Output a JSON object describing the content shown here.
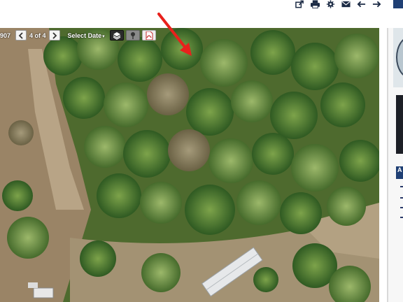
{
  "header": {
    "tools": [
      {
        "name": "share-icon"
      },
      {
        "name": "print-icon"
      },
      {
        "name": "gear-icon"
      },
      {
        "name": "mail-icon"
      },
      {
        "name": "arrow-left-icon"
      },
      {
        "name": "arrow-right-icon"
      }
    ],
    "accent": "#1f3f74"
  },
  "viewer": {
    "id_fragment": "907",
    "image_count": "4 of 4",
    "select_date_label": "Select Date",
    "annotation_color": "#e8211c"
  },
  "sidebar": {
    "tab_letter": "A"
  }
}
